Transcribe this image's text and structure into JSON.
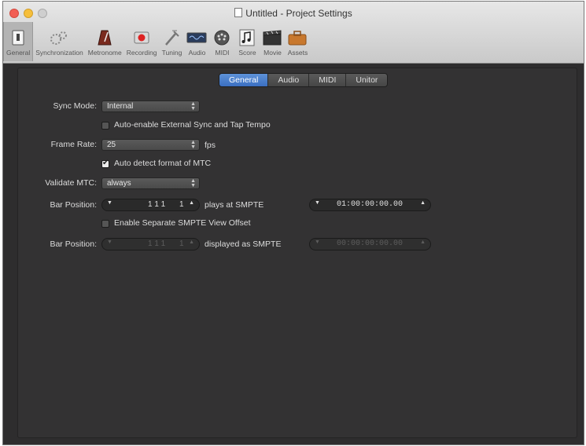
{
  "window": {
    "title": "Untitled - Project Settings"
  },
  "toolbar": {
    "items": [
      {
        "label": "General",
        "icon": "general-icon"
      },
      {
        "label": "Synchronization",
        "icon": "synchronization-icon"
      },
      {
        "label": "Metronome",
        "icon": "metronome-icon"
      },
      {
        "label": "Recording",
        "icon": "recording-icon"
      },
      {
        "label": "Tuning",
        "icon": "tuning-icon"
      },
      {
        "label": "Audio",
        "icon": "audio-icon"
      },
      {
        "label": "MIDI",
        "icon": "midi-icon"
      },
      {
        "label": "Score",
        "icon": "score-icon"
      },
      {
        "label": "Movie",
        "icon": "movie-icon"
      },
      {
        "label": "Assets",
        "icon": "assets-icon"
      }
    ],
    "active": "General"
  },
  "tabs": {
    "items": [
      "General",
      "Audio",
      "MIDI",
      "Unitor"
    ],
    "active": "General"
  },
  "settings": {
    "sync_mode": {
      "label": "Sync Mode:",
      "value": "Internal"
    },
    "auto_enable": {
      "label": "Auto-enable External Sync and Tap Tempo",
      "checked": false
    },
    "frame_rate": {
      "label": "Frame Rate:",
      "value": "25",
      "unit": "fps"
    },
    "auto_detect": {
      "label": "Auto detect format of MTC",
      "checked": true
    },
    "validate_mtc": {
      "label": "Validate MTC:",
      "value": "always"
    },
    "bar_position_1": {
      "label": "Bar Position:",
      "value": "1 1 1",
      "sub": "1",
      "plays_at": "plays at SMPTE",
      "smpte": "01:00:00:00.00"
    },
    "separate_offset": {
      "label": "Enable Separate SMPTE View Offset",
      "checked": false
    },
    "bar_position_2": {
      "label": "Bar Position:",
      "value": "1 1 1",
      "sub": "1",
      "displayed_as": "displayed as SMPTE",
      "smpte": "00:00:00:00.00"
    }
  }
}
